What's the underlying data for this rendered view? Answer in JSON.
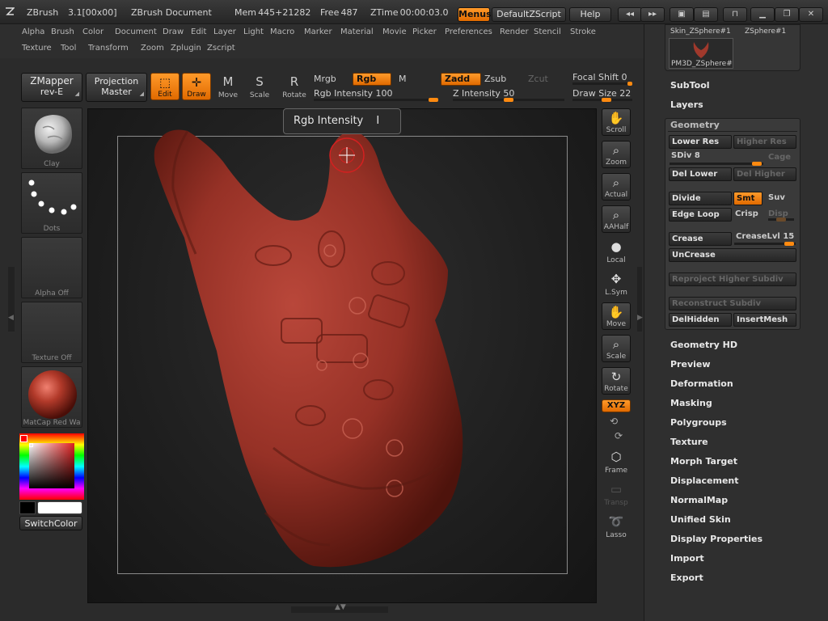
{
  "titlebar": {
    "app": "ZBrush",
    "version": "3.1[00x00]",
    "document": "ZBrush Document",
    "mem": "Mem 445+21282",
    "free": "Free 487",
    "ztime": "ZTime 00:00:03.0",
    "menus_btn": "Menus",
    "script_btn": "DefaultZScript",
    "help_btn": "Help"
  },
  "menubar": {
    "row1": [
      "Alpha",
      "Brush",
      "Color",
      "Document",
      "Draw",
      "Edit",
      "Layer",
      "Light",
      "Macro",
      "Marker",
      "Material",
      "Movie",
      "Picker",
      "Preferences",
      "Render",
      "Stencil",
      "Stroke"
    ],
    "row2": [
      "Texture",
      "Tool",
      "Transform",
      "Zoom",
      "Zplugin",
      "Zscript"
    ]
  },
  "shelf": {
    "zmapper_line1": "ZMapper",
    "zmapper_line2": "rev-E",
    "projection_line1": "Projection",
    "projection_line2": "Master",
    "edit": "Edit",
    "draw": "Draw",
    "move": "Move",
    "scale": "Scale",
    "rotate": "Rotate",
    "mrgb": "Mrgb",
    "rgb": "Rgb",
    "m": "M",
    "zadd": "Zadd",
    "zsub": "Zsub",
    "zcut": "Zcut",
    "rgb_intensity": "Rgb Intensity 100",
    "z_intensity": "Z Intensity 50",
    "focal_shift": "Focal Shift 0",
    "draw_size": "Draw Size 22"
  },
  "sliders": {
    "rgb_intensity": 100,
    "z_intensity": 50,
    "focal_shift": 0,
    "draw_size": 22
  },
  "left_panel": {
    "brush": "Clay",
    "stroke": "Dots",
    "alpha": "Alpha Off",
    "texture": "Texture Off",
    "material": "MatCap Red Wa",
    "switch_color": "SwitchColor"
  },
  "tooltip": {
    "text": "Rgb Intensity",
    "shortcut": "I"
  },
  "viewtools": {
    "scroll": "Scroll",
    "zoom": "Zoom",
    "actual": "Actual",
    "aahalf": "AAHalf",
    "local": "Local",
    "lsym": "L.Sym",
    "move": "Move",
    "scale": "Scale",
    "rotate": "Rotate",
    "xyz": "XYZ",
    "frame": "Frame",
    "transp": "Transp",
    "lasso": "Lasso"
  },
  "right_panel": {
    "tool_thumb_1": "Skin_ZSphere#1",
    "tool_thumb_2": "ZSphere#1",
    "tool_thumb_3": "PM3D_ZSphere#",
    "subtool": "SubTool",
    "layers": "Layers",
    "geometry": {
      "title": "Geometry",
      "lower_res": "Lower Res",
      "higher_res": "Higher Res",
      "sdiv": "SDiv 8",
      "cage": "Cage",
      "del_lower": "Del Lower",
      "del_higher": "Del Higher",
      "divide": "Divide",
      "smt": "Smt",
      "suv": "Suv",
      "edge_loop": "Edge Loop",
      "crisp": "Crisp",
      "disp": "Disp",
      "crease": "Crease",
      "crease_lvl": "CreaseLvl 15",
      "uncrease": "UnCrease",
      "reproject": "Reproject Higher Subdiv",
      "reconstruct": "Reconstruct Subdiv",
      "delhidden": "DelHidden",
      "insertmesh": "InsertMesh"
    },
    "sections": [
      "Geometry HD",
      "Preview",
      "Deformation",
      "Masking",
      "Polygroups",
      "Texture",
      "Morph Target",
      "Displacement",
      "NormalMap",
      "Unified Skin",
      "Display Properties",
      "Import",
      "Export"
    ]
  },
  "colors": {
    "accent": "#ff8a10",
    "model": "#a0392c",
    "primary_color": "#ffffff",
    "secondary_color": "#000000"
  }
}
